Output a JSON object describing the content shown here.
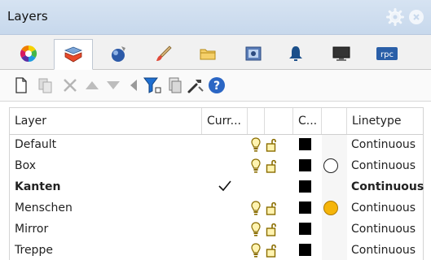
{
  "window": {
    "title": "Layers"
  },
  "tabs": [
    {
      "name": "color-wheel-icon"
    },
    {
      "name": "layer-stack-icon",
      "active": true
    },
    {
      "name": "render-sphere-icon"
    },
    {
      "name": "paintbrush-icon"
    },
    {
      "name": "folder-icon"
    },
    {
      "name": "display-icon"
    },
    {
      "name": "bell-icon"
    },
    {
      "name": "monitor-icon"
    },
    {
      "name": "rpc-icon",
      "label": "rpc"
    }
  ],
  "toolbar": {
    "items": [
      "new-layer-icon",
      "new-sublayer-icon",
      "delete-icon",
      "move-up-icon",
      "move-down-icon",
      "move-left-icon",
      "filter-icon",
      "copy-icon",
      "tools-icon",
      "help-icon"
    ]
  },
  "table": {
    "headers": {
      "layer": "Layer",
      "current": "Curr...",
      "col3": "",
      "col4": "",
      "color": "C...",
      "material": "",
      "linetype": "Linetype"
    },
    "rows": [
      {
        "name": "Default",
        "current": false,
        "visible": true,
        "unlocked": true,
        "color": "#000000",
        "material": "none",
        "linetype": "Continuous",
        "bold": false
      },
      {
        "name": "Box",
        "current": false,
        "visible": true,
        "unlocked": true,
        "color": "#000000",
        "material": "empty",
        "linetype": "Continuous",
        "bold": false
      },
      {
        "name": "Kanten",
        "current": true,
        "visible": false,
        "unlocked": false,
        "color": "#000000",
        "material": "none",
        "linetype": "Continuous",
        "bold": true
      },
      {
        "name": "Menschen",
        "current": false,
        "visible": true,
        "unlocked": true,
        "color": "#000000",
        "material": "gold",
        "linetype": "Continuous",
        "bold": false
      },
      {
        "name": "Mirror",
        "current": false,
        "visible": true,
        "unlocked": true,
        "color": "#000000",
        "material": "none",
        "linetype": "Continuous",
        "bold": false
      },
      {
        "name": "Treppe",
        "current": false,
        "visible": true,
        "unlocked": true,
        "color": "#000000",
        "material": "none",
        "linetype": "Continuous",
        "bold": false
      }
    ]
  },
  "colors": {
    "title_bar": "#c7d8ec",
    "gold_material": "#f5b50a",
    "accent_blue": "#1f6fd1"
  }
}
